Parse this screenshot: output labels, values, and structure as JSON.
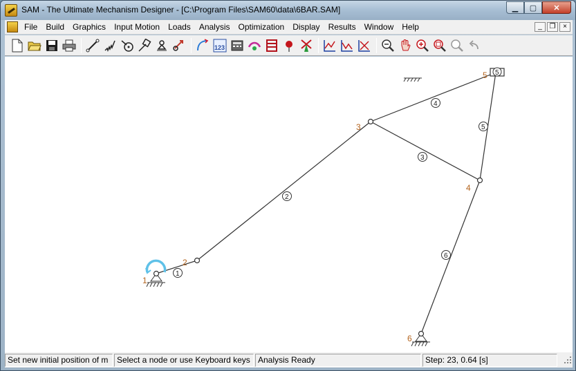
{
  "window": {
    "title": "SAM - The Ultimate Mechanism Designer - [C:\\Program Files\\SAM60\\data\\6BAR.SAM]",
    "controls": {
      "minimize": "▁",
      "maximize": "▢",
      "close": "✕"
    }
  },
  "menubar": {
    "items": [
      "File",
      "Build",
      "Graphics",
      "Input Motion",
      "Loads",
      "Analysis",
      "Optimization",
      "Display",
      "Results",
      "Window",
      "Help"
    ],
    "mdi_controls": {
      "minimize": "_",
      "restore": "❐",
      "close": "×"
    }
  },
  "toolbar": {
    "buttons": [
      "new-file-icon",
      "open-folder-icon",
      "save-disk-icon",
      "print-icon",
      "sep",
      "beam-element-icon",
      "spring-element-icon",
      "gear-element-icon",
      "slider-element-icon",
      "fixed-support-icon",
      "force-input-icon",
      "sep",
      "input-motion-icon",
      "table-123-icon",
      "calculator-icon",
      "analysis-icon",
      "ladder-icon",
      "pin-icon",
      "windmill-icon",
      "sep",
      "xy-graph-icon",
      "xy-graph-2-icon",
      "xy-graph-3-icon",
      "sep",
      "zoom-out-icon",
      "pan-hand-icon",
      "zoom-in-icon",
      "zoom-window-icon",
      "zoom-fit-icon",
      "undo-icon"
    ]
  },
  "mechanism": {
    "node_labels": [
      "1",
      "2",
      "3",
      "4",
      "5",
      "6"
    ],
    "link_labels": [
      "1",
      "2",
      "3",
      "4",
      "5",
      "6"
    ]
  },
  "statusbar": {
    "panels": [
      "Set new initial position of m",
      "Select a node or use Keyboard keys",
      "Analysis Ready",
      "Step: 23,    0.64 [s]"
    ]
  }
}
